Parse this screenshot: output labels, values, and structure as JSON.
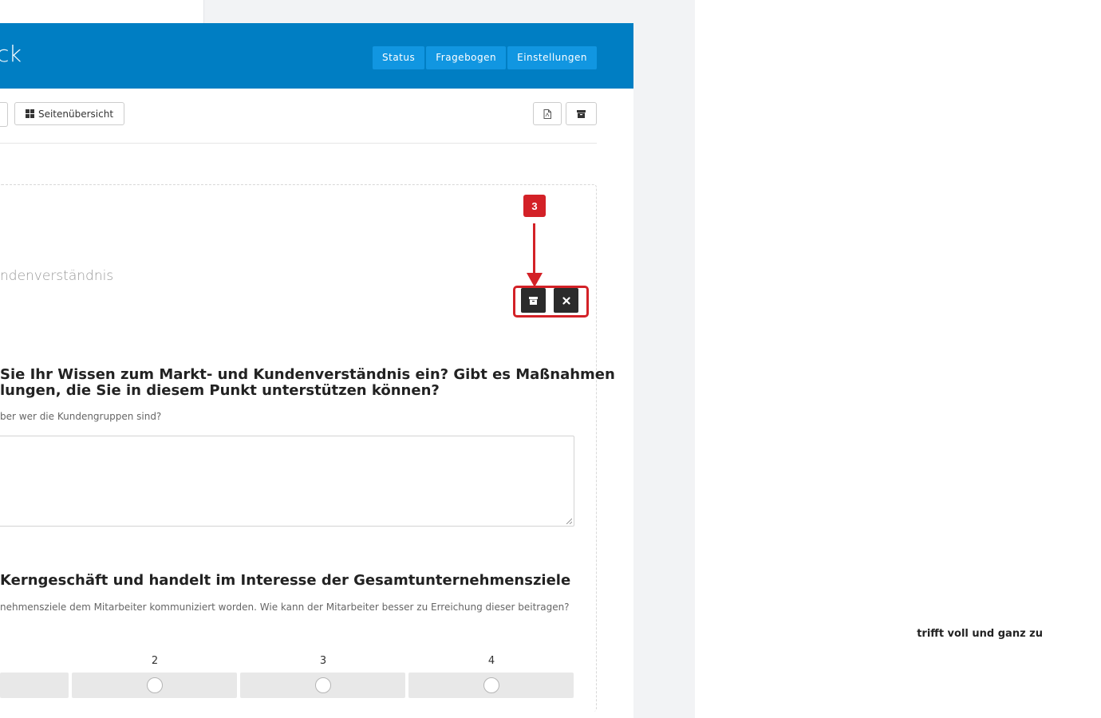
{
  "header": {
    "title_fragment": "ck",
    "nav": [
      "Status",
      "Fragebogen",
      "Einstellungen"
    ]
  },
  "toolbar": {
    "page_overview_label": "Seitenübersicht",
    "pdf_icon": "pdf-file-icon",
    "archive_icon": "archive-icon"
  },
  "annotation": {
    "badge_number": "3",
    "accent_color": "#d32127"
  },
  "section": {
    "title_fragment": "ndenverständnis",
    "archive_icon": "archive-icon",
    "delete_icon": "close-icon"
  },
  "questions": [
    {
      "title_line1": "Sie Ihr Wissen zum Markt- und Kundenverständnis ein? Gibt es Maßnahmen",
      "title_line2": "lungen, die Sie in diesem Punkt unterstützen können?",
      "help": "ber wer die Kundengruppen sind?"
    },
    {
      "title_line1": "Kerngeschäft und handelt im Interesse der Gesamtunternehmensziele",
      "help": "nehmensziele dem Mitarbeiter kommuniziert worden. Wie kann der Mitarbeiter besser zu Erreichung dieser beitragen?",
      "scale_max_label": "trifft voll und ganz zu",
      "scale_columns": [
        "2",
        "3",
        "4"
      ]
    }
  ],
  "colors": {
    "header_blue": "#007ec3",
    "nav_button_blue": "#1196e1",
    "dark_button": "#2b2b2b"
  }
}
